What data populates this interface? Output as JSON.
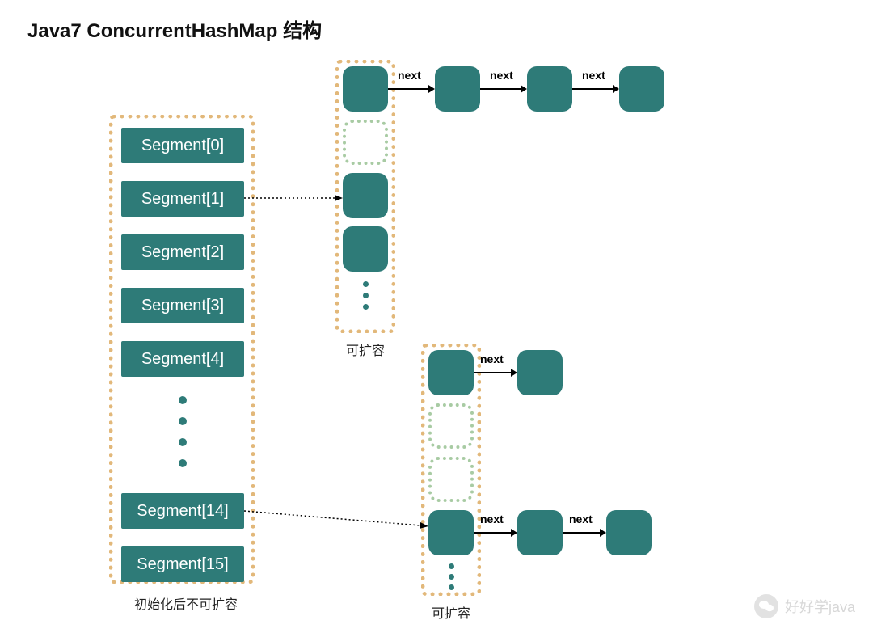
{
  "title": "Java7 ConcurrentHashMap 结构",
  "segments": {
    "s0": "Segment[0]",
    "s1": "Segment[1]",
    "s2": "Segment[2]",
    "s3": "Segment[3]",
    "s4": "Segment[4]",
    "s14": "Segment[14]",
    "s15": "Segment[15]"
  },
  "captions": {
    "segment_note": "初始化后不可扩容",
    "bucket_note_1": "可扩容",
    "bucket_note_2": "可扩容"
  },
  "labels": {
    "next": "next"
  },
  "watermark": {
    "text": "好好学java"
  }
}
